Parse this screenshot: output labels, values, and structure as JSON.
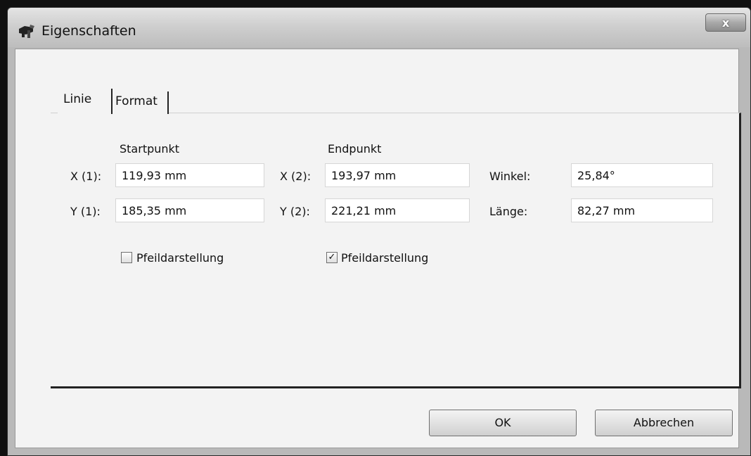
{
  "window": {
    "title": "Eigenschaften",
    "close_label": "x",
    "icon": "properties-icon"
  },
  "tabs": [
    {
      "label": "Linie",
      "selected": true
    },
    {
      "label": "Format",
      "selected": false
    }
  ],
  "start": {
    "heading": "Startpunkt",
    "x_label": "X (1):",
    "x_value": "119,93 mm",
    "y_label": "Y (1):",
    "y_value": "185,35 mm",
    "arrow_label": "Pfeildarstellung",
    "arrow_checked": false
  },
  "end": {
    "heading": "Endpunkt",
    "x_label": "X (2):",
    "x_value": "193,97 mm",
    "y_label": "Y (2):",
    "y_value": "221,21 mm",
    "arrow_label": "Pfeildarstellung",
    "arrow_checked": true
  },
  "measure": {
    "angle_label": "Winkel:",
    "angle_value": "25,84°",
    "length_label": "Länge:",
    "length_value": "82,27 mm"
  },
  "buttons": {
    "ok": "OK",
    "cancel": "Abbrechen"
  }
}
